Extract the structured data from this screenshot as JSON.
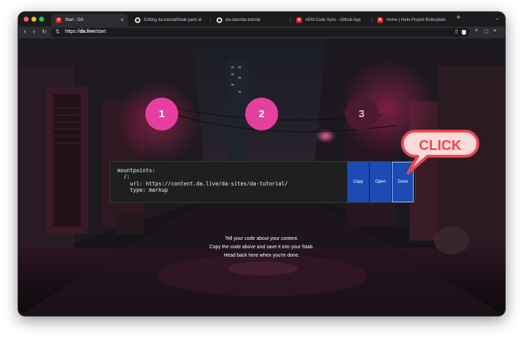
{
  "browser": {
    "tabs": [
      {
        "label": "Start - DA",
        "icon": "adobe-icon",
        "active": true
      },
      {
        "label": "Editing da-tutorial/fstab.yaml at",
        "icon": "github-icon"
      },
      {
        "label": "da-sites/da-tutorial",
        "icon": "github-icon"
      },
      {
        "label": "AEM Code Sync - Github App",
        "icon": "adobe-icon"
      },
      {
        "label": "Home | Helix Project Boilerplate",
        "icon": "adobe-icon"
      }
    ],
    "close_glyph": "×",
    "new_tab_glyph": "+",
    "tab_menu_glyph": "⌄",
    "url_prefix": "https://",
    "url_domain": "da.live",
    "url_path": "/start",
    "traffic_colors": [
      "#ff5f57",
      "#febc2e",
      "#28c840"
    ]
  },
  "steps": [
    {
      "number": "1",
      "state": "active"
    },
    {
      "number": "2",
      "state": "active"
    },
    {
      "number": "3",
      "state": "inactive"
    }
  ],
  "code_block": {
    "line1": "mountpoints:",
    "line2": "  /:",
    "line3": "    url: https://content.da.live/da-sites/da-tutorial/",
    "line4": "    type: markup"
  },
  "actions": {
    "copy_label": "Copy",
    "open_label": "Open",
    "done_label": "Done"
  },
  "callout": {
    "text": "CLICK"
  },
  "instructions": {
    "line1": "Tell your code about your content.",
    "line2": "Copy the code above and save it into your fstab.",
    "line3": "Head back here when you're done."
  },
  "colors": {
    "step_active": "#e63fa0",
    "step_inactive": "#4c1a30",
    "button_blue": "#1c4bb5",
    "callout_red": "#e8484d",
    "callout_fill": "#fcd9da"
  }
}
